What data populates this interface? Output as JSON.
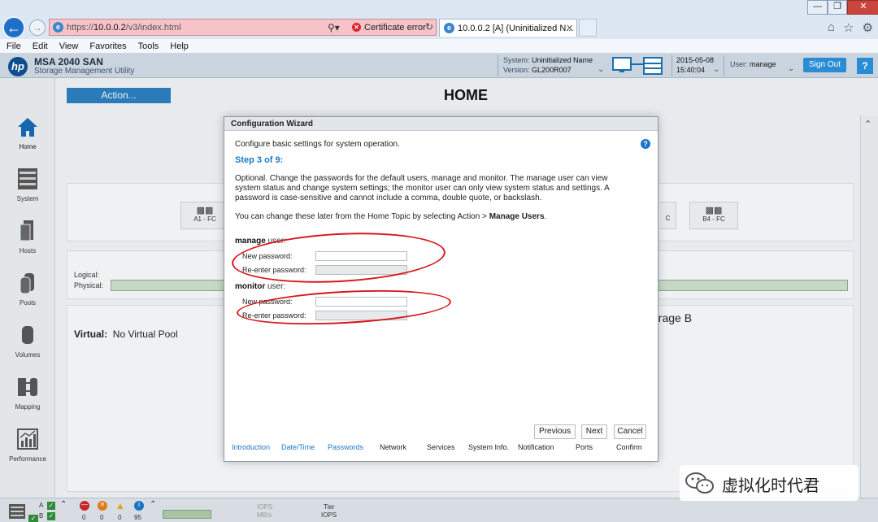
{
  "browser": {
    "url_prefix": "https://",
    "url_host": "10.0.0.2",
    "url_path": "/v3/index.html",
    "cert_error": "Certificate error",
    "tab_title": "10.0.0.2 [A] (Uninitialized N...",
    "menu": [
      "File",
      "Edit",
      "View",
      "Favorites",
      "Tools",
      "Help"
    ]
  },
  "header": {
    "product": "MSA 2040 SAN",
    "subtitle": "Storage Management Utility",
    "system_label": "System:",
    "system_value": "Uninitialized Name",
    "version_label": "Version:",
    "version_value": "GL200R007",
    "date": "2015-05-08",
    "time": "15:40:04",
    "user_label": "User:",
    "user_value": "manage",
    "sign_out": "Sign Out",
    "help": "?"
  },
  "nav": {
    "items": [
      {
        "label": "Home",
        "icon": "home-icon"
      },
      {
        "label": "System",
        "icon": "system-icon"
      },
      {
        "label": "Hosts",
        "icon": "hosts-icon"
      },
      {
        "label": "Pools",
        "icon": "pools-icon"
      },
      {
        "label": "Volumes",
        "icon": "volumes-icon"
      },
      {
        "label": "Mapping",
        "icon": "mapping-icon"
      },
      {
        "label": "Performance",
        "icon": "performance-icon"
      }
    ]
  },
  "main": {
    "action": "Action...",
    "title": "HOME",
    "ports": [
      "A1 - FC",
      "C",
      "B4 - FC"
    ],
    "logical": "Logical:",
    "physical": "Physical:",
    "virtual_label": "Virtual:",
    "virtual_value": "No Virtual Pool",
    "storage_b": "orage B"
  },
  "status": {
    "ctrl_a": "A",
    "ctrl_b": "B",
    "counts": [
      "0",
      "0",
      "0",
      "95"
    ],
    "iops_label": "IOPS",
    "mbs_label": "MB/s",
    "tier_label": "Tier",
    "tier_iops": "IOPS"
  },
  "wizard": {
    "title": "Configuration Wizard",
    "intro": "Configure basic settings for system operation.",
    "step": "Step 3 of 9:",
    "description": "Optional. Change the passwords for the default users, manage and monitor. The manage user can view system status and change system settings; the monitor user can only view system status and settings. A password is case-sensitive and cannot include a comma, double quote, or backslash.",
    "later_prefix": "You can change these later from the Home Topic by selecting Action > ",
    "later_bold": "Manage Users",
    "later_suffix": ".",
    "manage_user": "manage",
    "monitor_user": "monitor",
    "user_suffix": " user:",
    "new_password": "New password:",
    "reenter_password": "Re-enter password:",
    "buttons": {
      "previous": "Previous",
      "next": "Next",
      "cancel": "Cancel"
    },
    "steps": [
      "Introduction",
      "Date/Time",
      "Passwords",
      "Network",
      "Services",
      "System Info.",
      "Notification",
      "Ports",
      "Confirm"
    ]
  },
  "watermark": {
    "text": "虚拟化时代君"
  },
  "colors": {
    "accent": "#2a8dd4",
    "step_blue": "#1b78c8",
    "annotation_red": "#d8161b",
    "cert_error_bg": "#f5c3c8"
  }
}
